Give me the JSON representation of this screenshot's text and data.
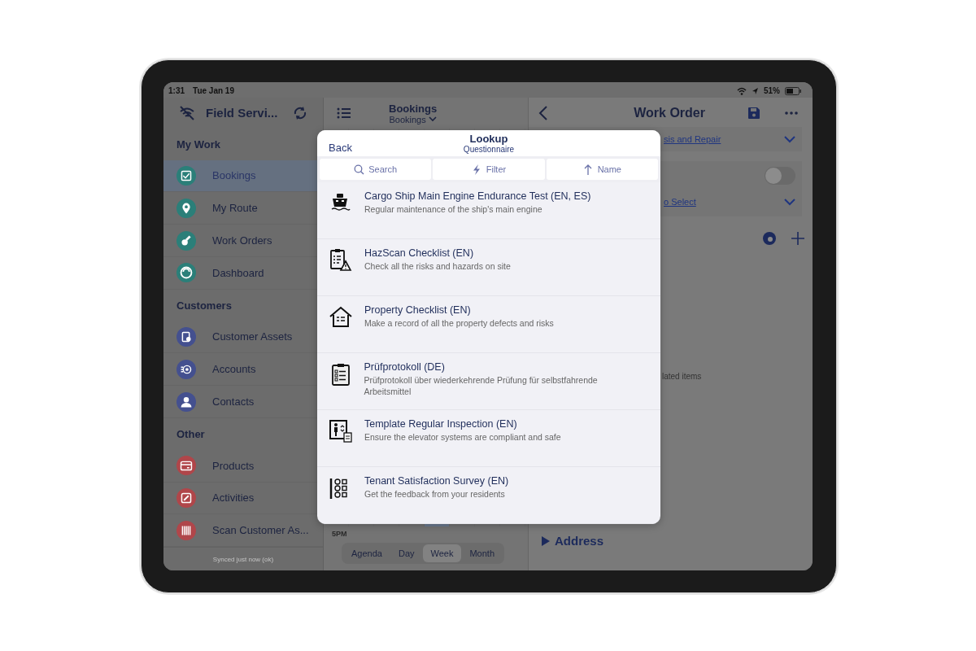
{
  "status_bar": {
    "time": "1:31",
    "date": "Tue Jan 19",
    "battery": "51%"
  },
  "sidebar": {
    "title": "Field Servi...",
    "sections": [
      {
        "header": "My Work",
        "items": [
          {
            "label": "Bookings",
            "kind": "calendar",
            "color": "#2b7f79",
            "selected": true
          },
          {
            "label": "My Route",
            "kind": "pin",
            "color": "#2b7f79",
            "selected": false
          },
          {
            "label": "Work Orders",
            "kind": "wrench",
            "color": "#2b7f79",
            "selected": false
          },
          {
            "label": "Dashboard",
            "kind": "gauge",
            "color": "#2b7f79",
            "selected": false
          }
        ]
      },
      {
        "header": "Customers",
        "items": [
          {
            "label": "Customer Assets",
            "kind": "assets",
            "color": "#44508f",
            "selected": false
          },
          {
            "label": "Accounts",
            "kind": "accounts",
            "color": "#44508f",
            "selected": false
          },
          {
            "label": "Contacts",
            "kind": "person",
            "color": "#44508f",
            "selected": false
          }
        ]
      },
      {
        "header": "Other",
        "items": [
          {
            "label": "Products",
            "kind": "card",
            "color": "#b0464a",
            "selected": false
          },
          {
            "label": "Activities",
            "kind": "pencil",
            "color": "#b0464a",
            "selected": false
          },
          {
            "label": "Scan Customer As...",
            "kind": "barcode",
            "color": "#b0464a",
            "selected": false
          }
        ]
      }
    ],
    "footer": "Synced just now (ok)"
  },
  "bookings": {
    "title": "Bookings",
    "subtitle": "Bookings",
    "time_label": "5PM",
    "views": [
      {
        "label": "Agenda",
        "selected": false
      },
      {
        "label": "Day",
        "selected": false
      },
      {
        "label": "Week",
        "selected": true
      },
      {
        "label": "Month",
        "selected": false
      }
    ]
  },
  "work_order": {
    "title": "Work Order",
    "link_1": "sis and Repair",
    "toggle": {
      "on": false
    },
    "link_2": "o Select",
    "text": "lated items",
    "section": "Address"
  },
  "lookup": {
    "back": "Back",
    "title": "Lookup",
    "subtitle": "Questionnaire",
    "toolbar": [
      {
        "kind": "search",
        "label": "Search"
      },
      {
        "kind": "filter",
        "label": "Filter"
      },
      {
        "kind": "sort",
        "label": "Name"
      }
    ],
    "items": [
      {
        "kind": "ship",
        "title": "Cargo Ship Main Engine Endurance Test (EN, ES)",
        "description": "Regular maintenance of the ship's main engine"
      },
      {
        "kind": "hazard",
        "title": "HazScan Checklist (EN)",
        "description": "Check all the risks and hazards on site"
      },
      {
        "kind": "house",
        "title": "Property Checklist (EN)",
        "description": "Make a record of all the property defects and risks"
      },
      {
        "kind": "clipboard",
        "title": "Prüfprotokoll (DE)",
        "description": "Prüfprotokoll über wiederkehrende Prüfung für selbstfahrende Arbeitsmittel"
      },
      {
        "kind": "elevator",
        "title": "Template Regular Inspection (EN)",
        "description": "Ensure the elevator systems are compliant and safe"
      },
      {
        "kind": "survey",
        "title": "Tenant Satisfaction Survey (EN)",
        "description": "Get the feedback from your residents"
      }
    ]
  }
}
